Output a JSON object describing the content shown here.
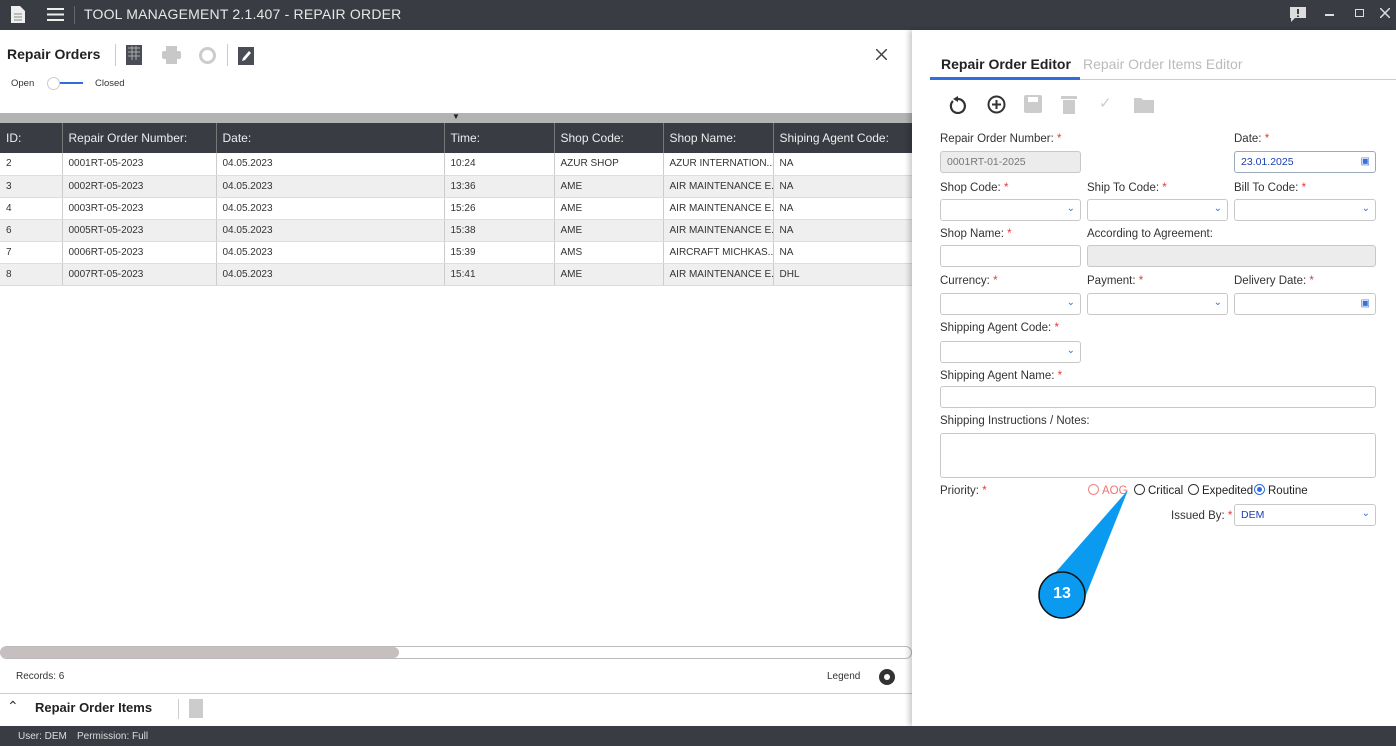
{
  "app": {
    "title": "TOOL MANAGEMENT 2.1.407 - REPAIR ORDER"
  },
  "left": {
    "title": "Repair Orders",
    "toggle_open": "Open",
    "toggle_closed": "Closed",
    "toggle_state": "closed",
    "columns": [
      "ID:",
      "Repair Order Number:",
      "Date:",
      "Time:",
      "Shop Code:",
      "Shop Name:",
      "Shiping Agent Code:"
    ],
    "rows": [
      [
        "2",
        "0001RT-05-2023",
        "04.05.2023",
        "10:24",
        "AZUR SHOP",
        "AZUR INTERNATION...",
        "NA"
      ],
      [
        "3",
        "0002RT-05-2023",
        "04.05.2023",
        "13:36",
        "AME",
        "AIR MAINTENANCE E...",
        "NA"
      ],
      [
        "4",
        "0003RT-05-2023",
        "04.05.2023",
        "15:26",
        "AME",
        "AIR MAINTENANCE E...",
        "NA"
      ],
      [
        "6",
        "0005RT-05-2023",
        "04.05.2023",
        "15:38",
        "AME",
        "AIR MAINTENANCE E...",
        "NA"
      ],
      [
        "7",
        "0006RT-05-2023",
        "04.05.2023",
        "15:39",
        "AMS",
        "AIRCRAFT MICHKAS...",
        "NA"
      ],
      [
        "8",
        "0007RT-05-2023",
        "04.05.2023",
        "15:41",
        "AME",
        "AIR MAINTENANCE E...",
        "DHL"
      ]
    ],
    "records": "Records: 6",
    "legend": "Legend",
    "items_title": "Repair Order Items"
  },
  "editor": {
    "tabs": [
      "Repair Order Editor",
      "Repair Order Items Editor"
    ],
    "labels": {
      "ro_number": "Repair Order Number:",
      "date": "Date:",
      "shop_code": "Shop Code:",
      "ship_to": "Ship To Code:",
      "bill_to": "Bill To Code:",
      "shop_name": "Shop Name:",
      "agreement": "According to Agreement:",
      "currency": "Currency:",
      "payment": "Payment:",
      "delivery": "Delivery Date:",
      "agent_code": "Shipping Agent Code:",
      "agent_name": "Shipping Agent Name:",
      "notes": "Shipping Instructions / Notes:",
      "priority": "Priority:",
      "issued_by": "Issued By:"
    },
    "required_mark": "*",
    "values": {
      "ro_number": "0001RT-01-2025",
      "date": "23.01.2025",
      "issued_by": "DEM"
    },
    "priority_options": [
      "AOG",
      "Critical",
      "Expedited",
      "Routine"
    ],
    "priority_selected": "Routine"
  },
  "callout": {
    "number": "13",
    "color": "#0a9af0"
  },
  "status": {
    "user": "User: DEM",
    "permission": "Permission: Full"
  }
}
